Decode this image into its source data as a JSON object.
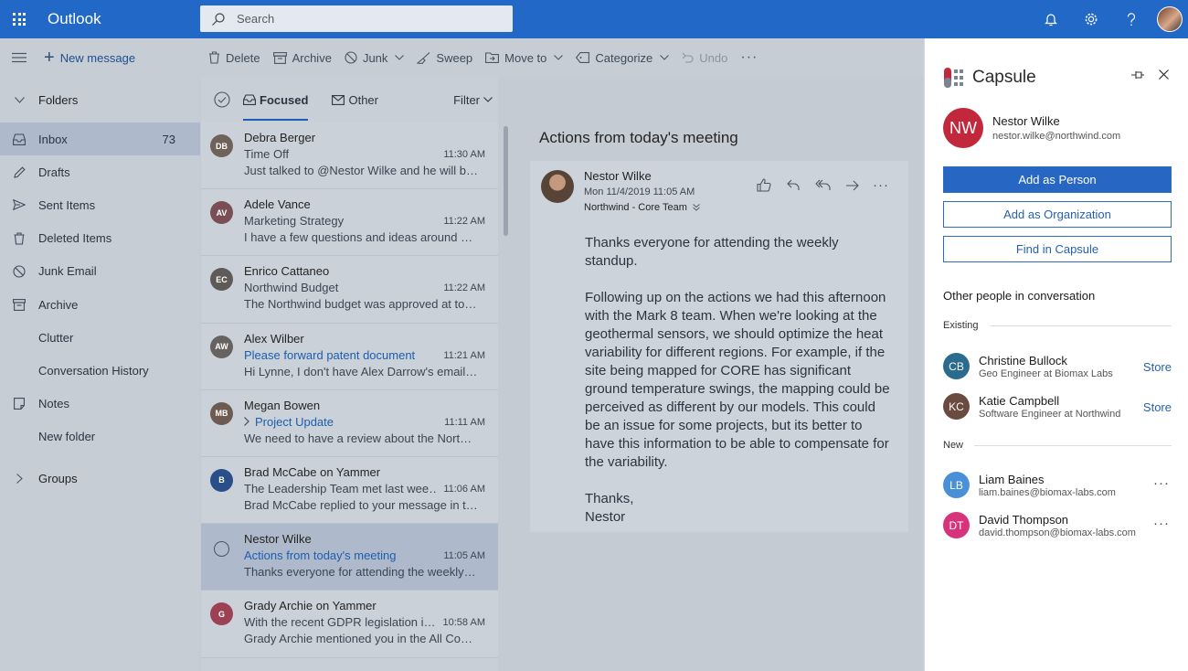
{
  "app": {
    "name": "Outlook"
  },
  "search": {
    "placeholder": "Search"
  },
  "colors": {
    "brand": "#2268c6",
    "capsule_red": "#c2283b",
    "accent_blue": "#2866c4"
  },
  "commands": {
    "new_message": "New message",
    "delete": "Delete",
    "archive": "Archive",
    "junk": "Junk",
    "sweep": "Sweep",
    "move_to": "Move to",
    "categorize": "Categorize",
    "undo": "Undo"
  },
  "folders": {
    "heading": "Folders",
    "items": [
      {
        "label": "Inbox",
        "count": "73",
        "icon": "inbox-icon"
      },
      {
        "label": "Drafts",
        "count": "",
        "icon": "pencil-icon"
      },
      {
        "label": "Sent Items",
        "count": "",
        "icon": "send-icon"
      },
      {
        "label": "Deleted Items",
        "count": "",
        "icon": "trash-icon"
      },
      {
        "label": "Junk Email",
        "count": "",
        "icon": "block-icon"
      },
      {
        "label": "Archive",
        "count": "",
        "icon": "archive-icon"
      },
      {
        "label": "Clutter",
        "count": "",
        "icon": ""
      },
      {
        "label": "Conversation History",
        "count": "",
        "icon": ""
      },
      {
        "label": "Notes",
        "count": "",
        "icon": "note-icon"
      },
      {
        "label": "New folder",
        "count": "",
        "icon": ""
      }
    ],
    "groups": "Groups"
  },
  "list": {
    "tab_focused": "Focused",
    "tab_other": "Other",
    "filter": "Filter",
    "messages": [
      {
        "sender": "Debra Berger",
        "subject": "Time Off",
        "time": "11:30 AM",
        "preview": "Just talked to @Nestor Wilke and he will be…",
        "unread": false,
        "avatar": "DB",
        "avatar_color": "#6e6259"
      },
      {
        "sender": "Adele Vance",
        "subject": "Marketing Strategy",
        "time": "11:22 AM",
        "preview": "I have a few questions and ideas around our…",
        "unread": false,
        "avatar": "AV",
        "avatar_color": "#7a4e55"
      },
      {
        "sender": "Enrico Cattaneo",
        "subject": "Northwind Budget",
        "time": "11:22 AM",
        "preview": "The Northwind budget was approved at tod…",
        "unread": false,
        "avatar": "EC",
        "avatar_color": "#5e5a58"
      },
      {
        "sender": "Alex Wilber",
        "subject": "Please forward patent document",
        "time": "11:21 AM",
        "preview": "Hi Lynne, I don't have Alex Darrow's email a…",
        "unread": true,
        "avatar": "AW",
        "avatar_color": "#66625f"
      },
      {
        "sender": "Megan Bowen",
        "subject": "Project Update",
        "time": "11:11 AM",
        "preview": "We need to have a review about the Northwi…",
        "unread": true,
        "thread": true,
        "avatar": "MB",
        "avatar_color": "#6d5a50"
      },
      {
        "sender": "Brad McCabe on Yammer",
        "subject": "The Leadership Team met last wee…",
        "time": "11:06 AM",
        "preview": "Brad McCabe replied to your message in the…",
        "unread": false,
        "avatar": "B",
        "avatar_color": "#2a4f88"
      },
      {
        "sender": "Nestor Wilke",
        "subject": "Actions from today's meeting",
        "time": "11:05 AM",
        "preview": "Thanks everyone for attending the weekly st…",
        "unread": true,
        "selected": true,
        "avatar": "",
        "avatar_color": ""
      },
      {
        "sender": "Grady Archie on Yammer",
        "subject": "With the recent GDPR legislation i…",
        "time": "10:58 AM",
        "preview": "Grady Archie mentioned you in the All Com…",
        "unread": false,
        "avatar": "G",
        "avatar_color": "#9c4053"
      }
    ]
  },
  "reading": {
    "subject": "Actions from today's meeting",
    "from": "Nestor Wilke",
    "date": "Mon 11/4/2019 11:05 AM",
    "to": "Northwind - Core Team",
    "body": [
      "Thanks everyone for attending the weekly standup.",
      "Following up on the actions we had this afternoon with the Mark 8 team. When we're looking at the geothermal sensors, we should optimize the heat variability for different regions. For example, if the site being mapped for CORE has significant ground temperature swings, the mapping could be perceived as different by our models. This could be an issue for some projects, but its better to have this information to be able to compensate for the variability.",
      "Thanks,\nNestor"
    ]
  },
  "capsule": {
    "title": "Capsule",
    "person": {
      "initials": "NW",
      "name": "Nestor Wilke",
      "email": "nestor.wilke@northwind.com"
    },
    "add_person": "Add as Person",
    "add_org": "Add as Organization",
    "find": "Find in Capsule",
    "others_title": "Other people in conversation",
    "existing_label": "Existing",
    "new_label": "New",
    "existing": [
      {
        "initials": "CB",
        "name": "Christine Bullock",
        "sub": "Geo Engineer at Biomax Labs",
        "action": "Store",
        "color": "#2a6b8e"
      },
      {
        "initials": "KC",
        "name": "Katie Campbell",
        "sub": "Software Engineer at Northwind",
        "action": "Store",
        "color": "#6b4a3f"
      }
    ],
    "new": [
      {
        "initials": "LB",
        "name": "Liam Baines",
        "sub": "liam.baines@biomax-labs.com",
        "color": "#4a90d9"
      },
      {
        "initials": "DT",
        "name": "David Thompson",
        "sub": "david.thompson@biomax-labs.com",
        "color": "#d6337a"
      }
    ]
  }
}
